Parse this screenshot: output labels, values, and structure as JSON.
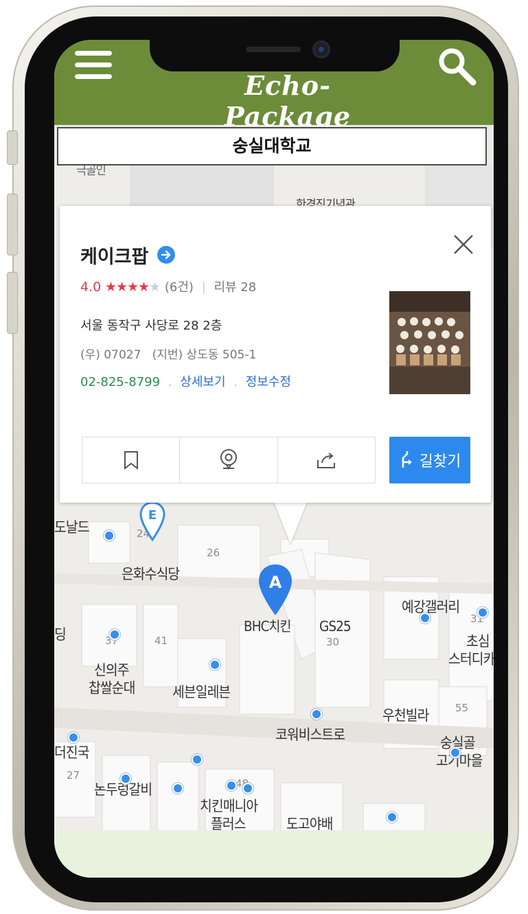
{
  "app": {
    "title": "Echo-Package",
    "location": "숭실대학교"
  },
  "place": {
    "name": "케이크팝",
    "rating": "4.0",
    "stars_filled": "★★★★",
    "stars_empty": "★",
    "rating_count": "(6건)",
    "reviews": "리뷰 28",
    "address": "서울 동작구 사당로 28 2층",
    "postal": "(우) 07027",
    "jibun": "(지번) 상도동 505-1",
    "phone": "02-825-8799",
    "detail_link": "상세보기",
    "edit_link": "정보수정",
    "route_label": "길찾기"
  },
  "map_labels": {
    "top_left": "극골인",
    "hangyeong": "한경직기념관",
    "mcdonald": "도날드",
    "eunhwa": "은화수식당",
    "bhc": "BHC치킨",
    "gs25": "GS25",
    "yegang": "예강갤러리",
    "dong": "딩",
    "sinuiju1": "신의주",
    "sinuiju2": "찹쌀순대",
    "seven": "세븐일레븐",
    "chosim1": "초심",
    "chosim2": "스터디카",
    "cowork": "코워비스트로",
    "woocheon": "우천빌라",
    "soongsil1": "숭실골",
    "soongsil2": "고기마을",
    "deojin": "더진국",
    "nondu": "논두렁갈비",
    "chicken1": "치킨매니아",
    "chicken2": "플러스",
    "partial": "도고야배"
  },
  "map_numbers": {
    "n24": "24",
    "n26": "26",
    "n37": "37",
    "n41": "41",
    "n30": "30",
    "n27": "27",
    "n48": "48",
    "n55": "55",
    "n31": "31"
  },
  "markers": {
    "a": "A",
    "e": "E"
  },
  "colors": {
    "header": "#6c8c3a",
    "accent": "#2e89ee",
    "rating": "#e8394a",
    "phone": "#2c8a4b",
    "link": "#2c6fd0"
  }
}
